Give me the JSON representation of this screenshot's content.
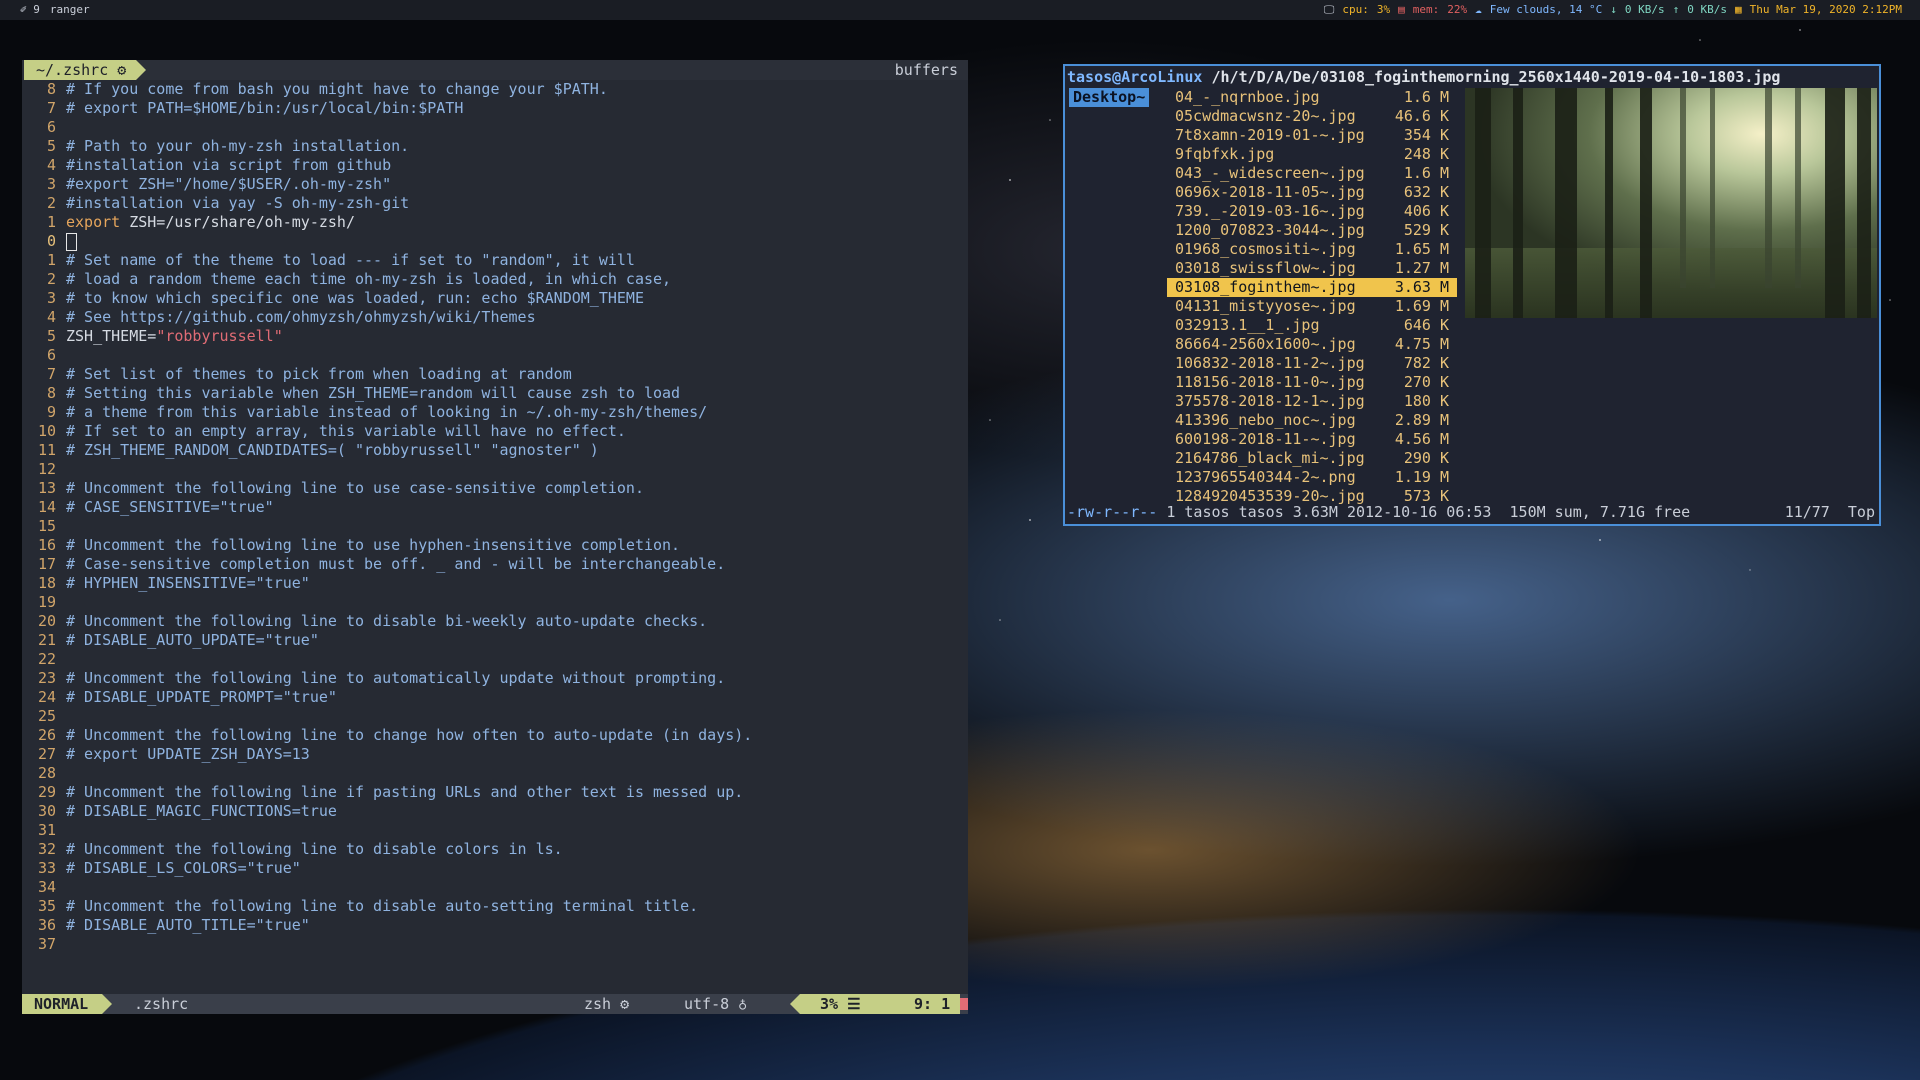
{
  "topbar": {
    "workspace": "9",
    "app": "ranger",
    "cpu_label": "cpu:",
    "cpu_value": "3%",
    "mem_label": "mem:",
    "mem_value": "22%",
    "weather": "Few clouds, 14 °C",
    "net_down": "0 KB/s",
    "net_up": "0 KB/s",
    "datetime": "Thu Mar 19, 2020   2:12PM"
  },
  "vim": {
    "tab_label": "~/.zshrc ⚙",
    "buffers_label": "buffers",
    "lines": [
      {
        "n": "8",
        "parts": [
          {
            "c": "cm",
            "t": "# If you come from bash you might have to change your $PATH."
          }
        ]
      },
      {
        "n": "7",
        "parts": [
          {
            "c": "cm",
            "t": "# export PATH=$HOME/bin:/usr/local/bin:$PATH"
          }
        ]
      },
      {
        "n": "6",
        "parts": []
      },
      {
        "n": "5",
        "parts": [
          {
            "c": "cm",
            "t": "# Path to your oh-my-zsh installation."
          }
        ]
      },
      {
        "n": "4",
        "parts": [
          {
            "c": "cm",
            "t": "#installation via script from github"
          }
        ]
      },
      {
        "n": "3",
        "parts": [
          {
            "c": "cm",
            "t": "#export ZSH=\"/home/$USER/.oh-my-zsh\""
          }
        ]
      },
      {
        "n": "2",
        "parts": [
          {
            "c": "cm",
            "t": "#installation via yay -S oh-my-zsh-git"
          }
        ]
      },
      {
        "n": "1",
        "parts": [
          {
            "c": "kw",
            "t": "export"
          },
          {
            "c": "pl",
            "t": " ZSH=/usr/share/oh-my-zsh/"
          }
        ]
      },
      {
        "n": "0",
        "cur": true,
        "parts": []
      },
      {
        "n": "1",
        "parts": [
          {
            "c": "cm",
            "t": "# Set name of the theme to load --- if set to \"random\", it will"
          }
        ]
      },
      {
        "n": "2",
        "parts": [
          {
            "c": "cm",
            "t": "# load a random theme each time oh-my-zsh is loaded, in which case,"
          }
        ]
      },
      {
        "n": "3",
        "parts": [
          {
            "c": "cm",
            "t": "# to know which specific one was loaded, run: echo $RANDOM_THEME"
          }
        ]
      },
      {
        "n": "4",
        "parts": [
          {
            "c": "cm",
            "t": "# See https://github.com/ohmyzsh/ohmyzsh/wiki/Themes"
          }
        ]
      },
      {
        "n": "5",
        "parts": [
          {
            "c": "pl",
            "t": "ZSH_THEME="
          },
          {
            "c": "st",
            "t": "\"robbyrussell\""
          }
        ]
      },
      {
        "n": "6",
        "parts": []
      },
      {
        "n": "7",
        "parts": [
          {
            "c": "cm",
            "t": "# Set list of themes to pick from when loading at random"
          }
        ]
      },
      {
        "n": "8",
        "parts": [
          {
            "c": "cm",
            "t": "# Setting this variable when ZSH_THEME=random will cause zsh to load"
          }
        ]
      },
      {
        "n": "9",
        "parts": [
          {
            "c": "cm",
            "t": "# a theme from this variable instead of looking in ~/.oh-my-zsh/themes/"
          }
        ]
      },
      {
        "n": "10",
        "parts": [
          {
            "c": "cm",
            "t": "# If set to an empty array, this variable will have no effect."
          }
        ]
      },
      {
        "n": "11",
        "parts": [
          {
            "c": "cm",
            "t": "# ZSH_THEME_RANDOM_CANDIDATES=( \"robbyrussell\" \"agnoster\" )"
          }
        ]
      },
      {
        "n": "12",
        "parts": []
      },
      {
        "n": "13",
        "parts": [
          {
            "c": "cm",
            "t": "# Uncomment the following line to use case-sensitive completion."
          }
        ]
      },
      {
        "n": "14",
        "parts": [
          {
            "c": "cm",
            "t": "# CASE_SENSITIVE=\"true\""
          }
        ]
      },
      {
        "n": "15",
        "parts": []
      },
      {
        "n": "16",
        "parts": [
          {
            "c": "cm",
            "t": "# Uncomment the following line to use hyphen-insensitive completion."
          }
        ]
      },
      {
        "n": "17",
        "parts": [
          {
            "c": "cm",
            "t": "# Case-sensitive completion must be off. _ and - will be interchangeable."
          }
        ]
      },
      {
        "n": "18",
        "parts": [
          {
            "c": "cm",
            "t": "# HYPHEN_INSENSITIVE=\"true\""
          }
        ]
      },
      {
        "n": "19",
        "parts": []
      },
      {
        "n": "20",
        "parts": [
          {
            "c": "cm",
            "t": "# Uncomment the following line to disable bi-weekly auto-update checks."
          }
        ]
      },
      {
        "n": "21",
        "parts": [
          {
            "c": "cm",
            "t": "# DISABLE_AUTO_UPDATE=\"true\""
          }
        ]
      },
      {
        "n": "22",
        "parts": []
      },
      {
        "n": "23",
        "parts": [
          {
            "c": "cm",
            "t": "# Uncomment the following line to automatically update without prompting."
          }
        ]
      },
      {
        "n": "24",
        "parts": [
          {
            "c": "cm",
            "t": "# DISABLE_UPDATE_PROMPT=\"true\""
          }
        ]
      },
      {
        "n": "25",
        "parts": []
      },
      {
        "n": "26",
        "parts": [
          {
            "c": "cm",
            "t": "# Uncomment the following line to change how often to auto-update (in days)."
          }
        ]
      },
      {
        "n": "27",
        "parts": [
          {
            "c": "cm",
            "t": "# export UPDATE_ZSH_DAYS=13"
          }
        ]
      },
      {
        "n": "28",
        "parts": []
      },
      {
        "n": "29",
        "parts": [
          {
            "c": "cm",
            "t": "# Uncomment the following line if pasting URLs and other text is messed up."
          }
        ]
      },
      {
        "n": "30",
        "parts": [
          {
            "c": "cm",
            "t": "# DISABLE_MAGIC_FUNCTIONS=true"
          }
        ]
      },
      {
        "n": "31",
        "parts": []
      },
      {
        "n": "32",
        "parts": [
          {
            "c": "cm",
            "t": "# Uncomment the following line to disable colors in ls."
          }
        ]
      },
      {
        "n": "33",
        "parts": [
          {
            "c": "cm",
            "t": "# DISABLE_LS_COLORS=\"true\""
          }
        ]
      },
      {
        "n": "34",
        "parts": []
      },
      {
        "n": "35",
        "parts": [
          {
            "c": "cm",
            "t": "# Uncomment the following line to disable auto-setting terminal title."
          }
        ]
      },
      {
        "n": "36",
        "parts": [
          {
            "c": "cm",
            "t": "# DISABLE_AUTO_TITLE=\"true\""
          }
        ]
      },
      {
        "n": "37",
        "parts": []
      }
    ],
    "status": {
      "mode": "NORMAL",
      "file": ".zshrc",
      "filetype": "zsh ⚙",
      "encoding": "utf-8 ♁",
      "percent": "3% ☰",
      "linecol": "9:  1"
    }
  },
  "ranger": {
    "title_user": "tasos@ArcoLinux",
    "title_path": " /h/t/D/A/De/03108_foginthemorning_2560x1440-2019-04-10-1803.jpg",
    "parent_dir": "Desktop~",
    "files": [
      {
        "name": "04_-_nqrnboe.jpg",
        "size": "1.6 M"
      },
      {
        "name": "05cwdmacwsnz-20~.jpg",
        "size": "46.6 K"
      },
      {
        "name": "7t8xamn-2019-01-~.jpg",
        "size": "354 K"
      },
      {
        "name": "9fqbfxk.jpg",
        "size": "248 K"
      },
      {
        "name": "043_-_widescreen~.jpg",
        "size": "1.6 M"
      },
      {
        "name": "0696x-2018-11-05~.jpg",
        "size": "632 K"
      },
      {
        "name": "739._-2019-03-16~.jpg",
        "size": "406 K"
      },
      {
        "name": "1200_070823-3044~.jpg",
        "size": "529 K"
      },
      {
        "name": "01968_cosmositi~.jpg",
        "size": "1.65 M"
      },
      {
        "name": "03018_swissflow~.jpg",
        "size": "1.27 M"
      },
      {
        "name": "03108_foginthem~.jpg",
        "size": "3.63 M",
        "selected": true
      },
      {
        "name": "04131_mistyyose~.jpg",
        "size": "1.69 M"
      },
      {
        "name": "032913.1__1_.jpg",
        "size": "646 K"
      },
      {
        "name": "86664-2560x1600~.jpg",
        "size": "4.75 M"
      },
      {
        "name": "106832-2018-11-2~.jpg",
        "size": "782 K"
      },
      {
        "name": "118156-2018-11-0~.jpg",
        "size": "270 K"
      },
      {
        "name": "375578-2018-12-1~.jpg",
        "size": "180 K"
      },
      {
        "name": "413396_nebo_noc~.jpg",
        "size": "2.89 M"
      },
      {
        "name": "600198-2018-11-~.jpg",
        "size": "4.56 M"
      },
      {
        "name": "2164786_black_mi~.jpg",
        "size": "290 K"
      },
      {
        "name": "1237965540344-2~.png",
        "size": "1.19 M"
      },
      {
        "name": "1284920453539-20~.jpg",
        "size": "573 K"
      }
    ],
    "status_perm": "-rw-r--r--",
    "status_info": " 1 tasos tasos 3.63M 2012-10-16 06:53",
    "status_sum": "150M sum, 7.71G free",
    "status_pos": "11/77",
    "status_scroll": "Top"
  }
}
